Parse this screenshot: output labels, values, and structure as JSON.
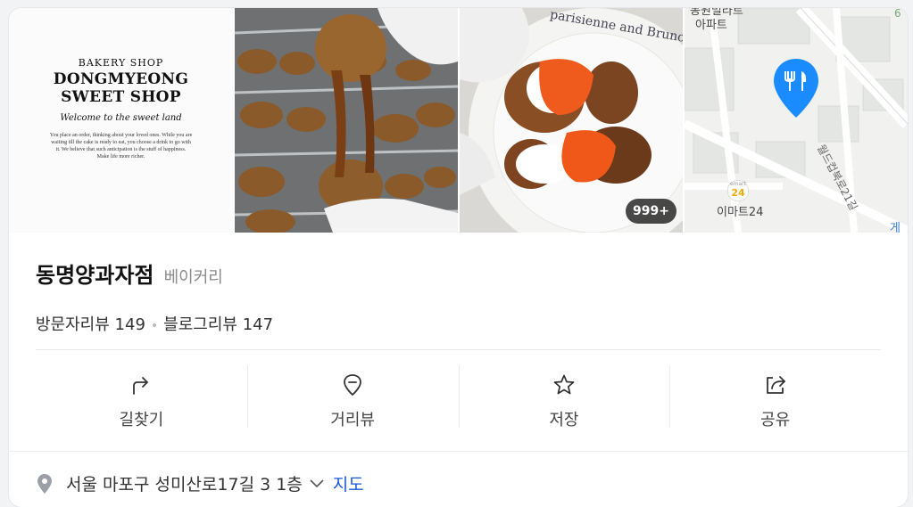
{
  "photos": {
    "poster": {
      "top_text": "BAKERY SHOP",
      "name_line1": "DONGMYEONG",
      "name_line2": "SWEET SHOP",
      "tagline": "Welcome to the sweet land",
      "body": "You place an order, thinking about your loved ones. While you are waiting till the cake is ready to eat, you choose a drink to go with it. We believe that such anticipation is the stuff of happiness. Make life more richer."
    },
    "plate_text": "parisienne and Brunch cafe",
    "more_count": "999+",
    "map": {
      "label_apartment_top": "동원밀라트",
      "label_apartment": "아파트",
      "label_store": "이마트24",
      "label_road": "월드컵북로21길",
      "label_edge": "게",
      "store_badge": "24",
      "store_badge_small": "emart"
    }
  },
  "place": {
    "name": "동명양과자점",
    "category": "베이커리",
    "visitor_reviews_label": "방문자리뷰",
    "visitor_reviews_count": "149",
    "blog_reviews_label": "블로그리뷰",
    "blog_reviews_count": "147",
    "separator": "•"
  },
  "actions": [
    {
      "label": "길찾기",
      "icon": "directions-icon"
    },
    {
      "label": "거리뷰",
      "icon": "street-view-icon"
    },
    {
      "label": "저장",
      "icon": "star-icon"
    },
    {
      "label": "공유",
      "icon": "share-icon"
    }
  ],
  "address": {
    "text": "서울 마포구 성미산로17길 3 1층",
    "map_link": "지도"
  },
  "colors": {
    "pin_blue": "#1a8cff",
    "link_blue": "#1a56d6"
  }
}
